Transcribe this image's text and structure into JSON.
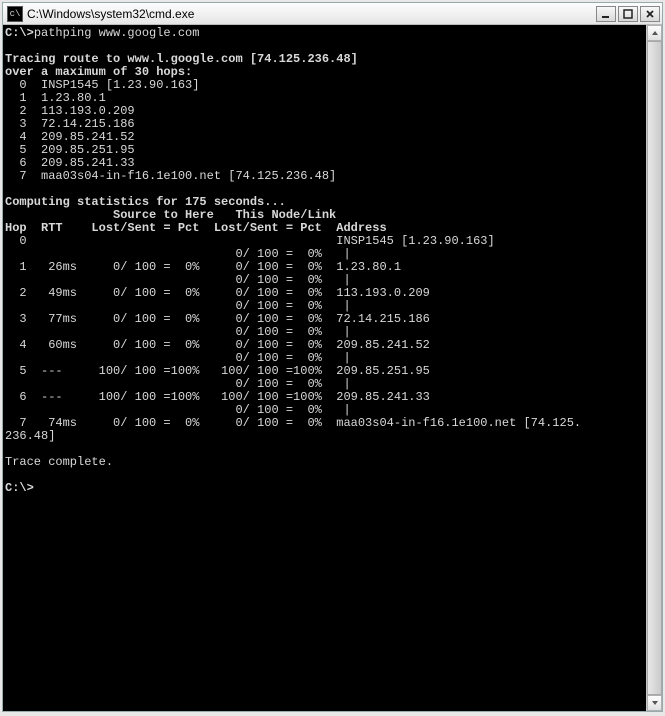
{
  "window": {
    "title": "C:\\Windows\\system32\\cmd.exe",
    "icon_label": "cmd"
  },
  "prompt": "C:\\>",
  "command": "pathping www.google.com",
  "trace_header1": "Tracing route to www.l.google.com [74.125.236.48]",
  "trace_header2": "over a maximum of 30 hops:",
  "hops": [
    "  0  INSP1545 [1.23.90.163]",
    "  1  1.23.80.1",
    "  2  113.193.0.209",
    "  3  72.14.215.186",
    "  4  209.85.241.52",
    "  5  209.85.251.95",
    "  6  209.85.241.33",
    "  7  maa03s04-in-f16.1e100.net [74.125.236.48]"
  ],
  "stats_header": "Computing statistics for 175 seconds...",
  "col_header1": "               Source to Here   This Node/Link",
  "col_header2": "Hop  RTT    Lost/Sent = Pct  Lost/Sent = Pct  Address",
  "stats_lines": [
    "  0                                           INSP1545 [1.23.90.163]",
    "                                0/ 100 =  0%   |",
    "  1   26ms     0/ 100 =  0%     0/ 100 =  0%  1.23.80.1",
    "                                0/ 100 =  0%   |",
    "  2   49ms     0/ 100 =  0%     0/ 100 =  0%  113.193.0.209",
    "                                0/ 100 =  0%   |",
    "  3   77ms     0/ 100 =  0%     0/ 100 =  0%  72.14.215.186",
    "                                0/ 100 =  0%   |",
    "  4   60ms     0/ 100 =  0%     0/ 100 =  0%  209.85.241.52",
    "                                0/ 100 =  0%   |",
    "  5  ---     100/ 100 =100%   100/ 100 =100%  209.85.251.95",
    "                                0/ 100 =  0%   |",
    "  6  ---     100/ 100 =100%   100/ 100 =100%  209.85.241.33",
    "                                0/ 100 =  0%   |",
    "  7   74ms     0/ 100 =  0%     0/ 100 =  0%  maa03s04-in-f16.1e100.net [74.125.",
    "236.48]"
  ],
  "complete": "Trace complete.",
  "prompt2": "C:\\>"
}
